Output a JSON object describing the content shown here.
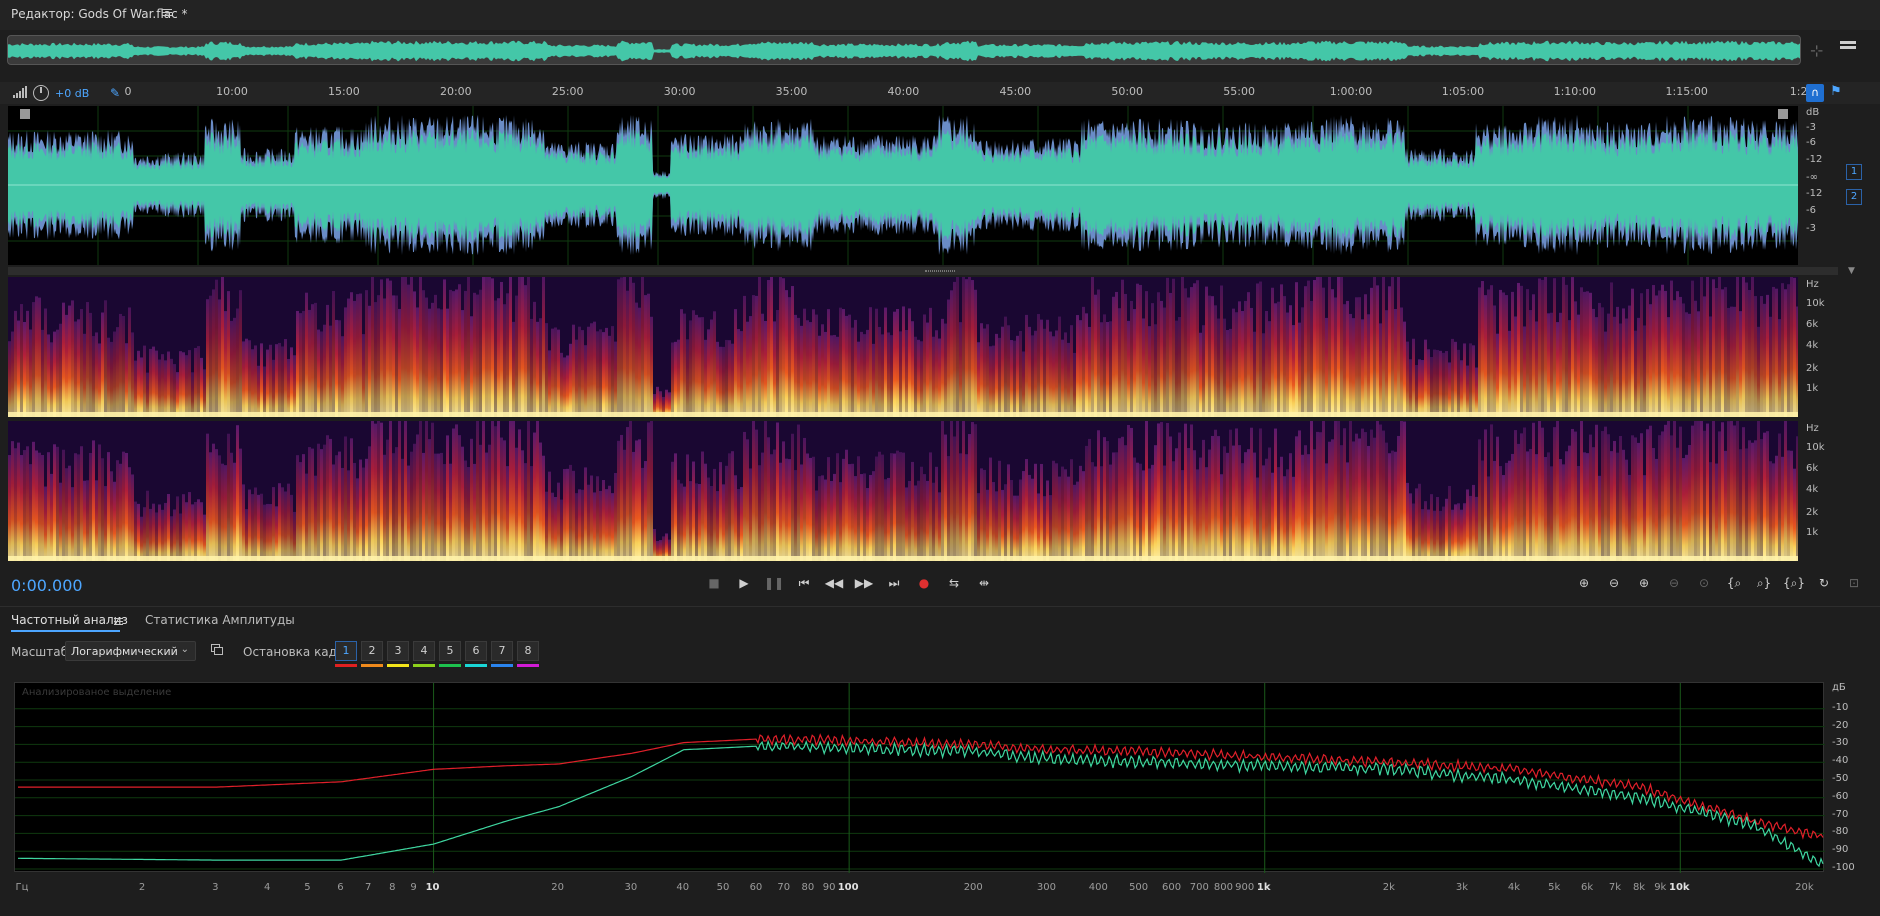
{
  "title": {
    "editor_title": "Редактор: Gods Of War.flac *"
  },
  "ruler": {
    "volume": "+0 dB",
    "ticks": [
      {
        "label": "0"
      },
      {
        "label": "10:00"
      },
      {
        "label": "15:00"
      },
      {
        "label": "20:00"
      },
      {
        "label": "25:00"
      },
      {
        "label": "30:00"
      },
      {
        "label": "35:00"
      },
      {
        "label": "40:00"
      },
      {
        "label": "45:00"
      },
      {
        "label": "50:00"
      },
      {
        "label": "55:00"
      },
      {
        "label": "1:00:00"
      },
      {
        "label": "1:05:00"
      },
      {
        "label": "1:10:00"
      },
      {
        "label": "1:15:00"
      },
      {
        "label": "1:2"
      }
    ]
  },
  "waveform": {
    "db_scale": [
      "dB",
      "-3",
      "-6",
      "-12",
      "-∞",
      "-12",
      "-6",
      "-3"
    ],
    "channels": [
      "1",
      "2"
    ],
    "colors": {
      "wave": "#44c7a8",
      "peak": "#6a8cc7",
      "background": "#000000"
    }
  },
  "spectrogram": {
    "hz_scale": [
      "Hz",
      "10k",
      "6k",
      "4k",
      "2k",
      "1k"
    ],
    "colors": [
      "#1a0732",
      "#5c1a6e",
      "#b31f3a",
      "#ee5a1e",
      "#fdd45a",
      "#fff2a8"
    ]
  },
  "transport": {
    "timecode": "0:00.000",
    "buttons": [
      {
        "name": "stop-button",
        "glyph": "■"
      },
      {
        "name": "play-button",
        "glyph": "▶"
      },
      {
        "name": "pause-button",
        "glyph": "❚❚"
      },
      {
        "name": "go-to-start-button",
        "glyph": "⏮"
      },
      {
        "name": "rewind-button",
        "glyph": "◀◀"
      },
      {
        "name": "fast-forward-button",
        "glyph": "▶▶"
      },
      {
        "name": "go-to-end-button",
        "glyph": "⏭"
      },
      {
        "name": "record-button",
        "glyph": "●"
      },
      {
        "name": "loop-button",
        "glyph": "⇆"
      },
      {
        "name": "skip-selection-button",
        "glyph": "⇹"
      }
    ],
    "zoom_buttons": [
      {
        "name": "zoom-in-amplitude-button",
        "glyph": "⊕"
      },
      {
        "name": "zoom-out-amplitude-button",
        "glyph": "⊖"
      },
      {
        "name": "zoom-in-time-button",
        "glyph": "⊕"
      },
      {
        "name": "zoom-out-full-button",
        "glyph": "⊖"
      },
      {
        "name": "zoom-selection-button",
        "glyph": "⊙"
      },
      {
        "name": "zoom-in-left-button",
        "glyph": "{⌕"
      },
      {
        "name": "zoom-in-right-button",
        "glyph": "⌕}"
      },
      {
        "name": "zoom-out-both-button",
        "glyph": "{⌕}"
      },
      {
        "name": "reset-zoom-button",
        "glyph": "↻"
      },
      {
        "name": "zoom-fit-button",
        "glyph": "⊡"
      }
    ]
  },
  "panel": {
    "tabs": [
      {
        "label": "Частотный анализ",
        "active": true
      },
      {
        "label": "Статистика Амплитуды",
        "active": false
      }
    ],
    "scale_label": "Масштаб:",
    "scale_value": "Логарифмический",
    "freeze_label": "Остановка кадра:",
    "freeze_frames": [
      {
        "label": "1",
        "color": "#e02020"
      },
      {
        "label": "2",
        "color": "#f08a1c"
      },
      {
        "label": "3",
        "color": "#f3e41a"
      },
      {
        "label": "4",
        "color": "#8ed11b"
      },
      {
        "label": "5",
        "color": "#1dc24e"
      },
      {
        "label": "6",
        "color": "#1ad6d6"
      },
      {
        "label": "7",
        "color": "#2a84ee"
      },
      {
        "label": "8",
        "color": "#d21bd6"
      }
    ]
  },
  "analysis": {
    "label": "Анализированое выделение",
    "db_unit": "дБ",
    "db_ticks": [
      "-10",
      "-20",
      "-30",
      "-40",
      "-50",
      "-60",
      "-70",
      "-80",
      "-90",
      "-100"
    ],
    "freq_ticks": [
      {
        "label": "Гц",
        "hz": 1,
        "major": false
      },
      {
        "label": "2",
        "hz": 2,
        "major": false
      },
      {
        "label": "3",
        "hz": 3,
        "major": false
      },
      {
        "label": "4",
        "hz": 4,
        "major": false
      },
      {
        "label": "5",
        "hz": 5,
        "major": false
      },
      {
        "label": "6",
        "hz": 6,
        "major": false
      },
      {
        "label": "7",
        "hz": 7,
        "major": false
      },
      {
        "label": "8",
        "hz": 8,
        "major": false
      },
      {
        "label": "9",
        "hz": 9,
        "major": false
      },
      {
        "label": "10",
        "hz": 10,
        "major": true
      },
      {
        "label": "20",
        "hz": 20,
        "major": false
      },
      {
        "label": "30",
        "hz": 30,
        "major": false
      },
      {
        "label": "40",
        "hz": 40,
        "major": false
      },
      {
        "label": "50",
        "hz": 50,
        "major": false
      },
      {
        "label": "60",
        "hz": 60,
        "major": false
      },
      {
        "label": "70",
        "hz": 70,
        "major": false
      },
      {
        "label": "80",
        "hz": 80,
        "major": false
      },
      {
        "label": "90",
        "hz": 90,
        "major": false
      },
      {
        "label": "100",
        "hz": 100,
        "major": true
      },
      {
        "label": "200",
        "hz": 200,
        "major": false
      },
      {
        "label": "300",
        "hz": 300,
        "major": false
      },
      {
        "label": "400",
        "hz": 400,
        "major": false
      },
      {
        "label": "500",
        "hz": 500,
        "major": false
      },
      {
        "label": "600",
        "hz": 600,
        "major": false
      },
      {
        "label": "700",
        "hz": 700,
        "major": false
      },
      {
        "label": "800",
        "hz": 800,
        "major": false
      },
      {
        "label": "900",
        "hz": 900,
        "major": false
      },
      {
        "label": "1k",
        "hz": 1000,
        "major": true
      },
      {
        "label": "2k",
        "hz": 2000,
        "major": false
      },
      {
        "label": "3k",
        "hz": 3000,
        "major": false
      },
      {
        "label": "4k",
        "hz": 4000,
        "major": false
      },
      {
        "label": "5k",
        "hz": 5000,
        "major": false
      },
      {
        "label": "6k",
        "hz": 6000,
        "major": false
      },
      {
        "label": "7k",
        "hz": 7000,
        "major": false
      },
      {
        "label": "8k",
        "hz": 8000,
        "major": false
      },
      {
        "label": "9k",
        "hz": 9000,
        "major": false
      },
      {
        "label": "10k",
        "hz": 10000,
        "major": true
      },
      {
        "label": "20k",
        "hz": 20000,
        "major": false
      }
    ],
    "colors": {
      "channel_left": "#e0202a",
      "channel_right": "#3fd6a0",
      "grid": "#0f3a0f"
    }
  },
  "chart_data": {
    "type": "line",
    "xscale": "log",
    "xlim": [
      1,
      22050
    ],
    "ylim": [
      -100,
      0
    ],
    "x": [
      1,
      3,
      6,
      10,
      15,
      20,
      30,
      40,
      60,
      100,
      200,
      300,
      500,
      1000,
      2000,
      4000,
      8000,
      15000,
      22050
    ],
    "series": [
      {
        "values": [
          -54,
          -54,
          -51,
          -44,
          -42,
          -41,
          -35,
          -29,
          -27,
          -28,
          -30,
          -33,
          -34,
          -37,
          -40,
          -44,
          -54,
          -73,
          -82
        ]
      },
      {
        "values": [
          -94,
          -95,
          -95,
          -86,
          -73,
          -65,
          -48,
          -33,
          -31,
          -32,
          -34,
          -38,
          -40,
          -42,
          -44,
          -50,
          -60,
          -75,
          -98
        ]
      }
    ]
  }
}
